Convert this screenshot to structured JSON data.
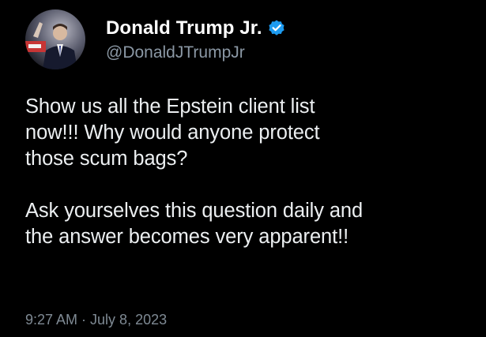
{
  "author": {
    "display_name": "Donald Trump Jr.",
    "handle": "@DonaldJTrumpJr",
    "verified": true,
    "verified_icon": "verified-badge-icon",
    "avatar_icon": "profile-avatar"
  },
  "tweet": {
    "paragraphs": [
      "Show us all the Epstein client list\nnow!!! Why would anyone protect\nthose scum bags?",
      "Ask yourselves this question daily and\nthe answer becomes very apparent!!"
    ]
  },
  "meta": {
    "time": "9:27 AM",
    "separator": "·",
    "date": "July 8, 2023"
  },
  "colors": {
    "background": "#000000",
    "verified_blue": "#1d9bf0",
    "name": "#ffffff",
    "secondary_text": "#8b98a5"
  }
}
